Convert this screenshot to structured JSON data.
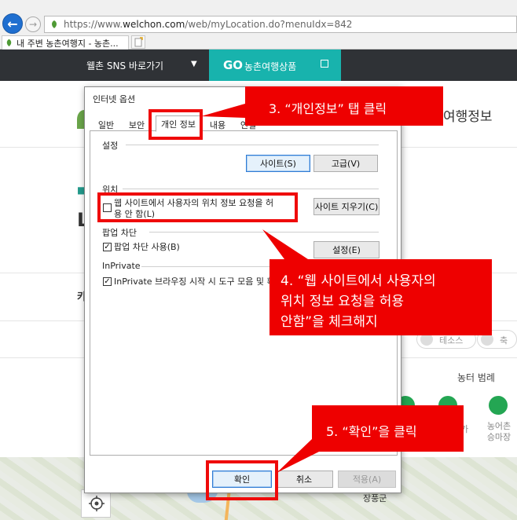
{
  "browser": {
    "address_prefix": "https://www.",
    "address_domain": "welchon.com",
    "address_path": "/web/myLocation.do?menuIdx=842",
    "tab_title": "내 주변 농촌여행지 - 농촌..."
  },
  "site": {
    "sns_label": "웰촌 SNS 바로가기",
    "sns_caret": "▼",
    "go_bold": "GO",
    "go_label": "농촌여행상품",
    "menu_tail": "여행정보",
    "big_letter": "L",
    "side_letter": "카",
    "pill_1": "테소스",
    "pill_2": "축",
    "farm_header": "농터 범례",
    "cat_left_label": "가",
    "cat_right_label": "농어촌\n승마장",
    "map_town": "장풍군"
  },
  "dialog": {
    "title": "인터넷 옵션",
    "tabs": [
      "일반",
      "보안",
      "개인 정보",
      "내용",
      "연결"
    ],
    "settings_label": "설정",
    "btn_sites": "사이트(S)",
    "btn_advanced": "고급(V)",
    "location_label": "위치",
    "location_checkbox_line1": "웹 사이트에서 사용자의 위치 정보 요청을 허",
    "location_checkbox_line2": "용 안 함(L)",
    "btn_clear_sites": "사이트 지우기(C)",
    "popup_label": "팝업 차단",
    "popup_checkbox": "팝업 차단 사용(B)",
    "btn_popup_settings": "설정(E)",
    "inprivate_label": "InPrivate",
    "inprivate_checkbox": "InPrivate 브라우징 시작 시 도구 모음 및 확장",
    "btn_ok": "확인",
    "btn_cancel": "취소",
    "btn_apply": "적용(A)",
    "checkmark": "✓"
  },
  "annotations": {
    "step3": "3. “개인정보” 탭 클릭",
    "step4_l1": "4. “웹 사이트에서 사용자의",
    "step4_l2": "위치 정보 요청을 허용",
    "step4_l3": "안함”을 체크해지",
    "step5": "5. “확인”을 클릭",
    "color": "#ee0000"
  },
  "colors": {
    "site_dark_bar": "#2f3236",
    "site_teal": "#18b3ad",
    "browser_back": "#1f6fd0"
  }
}
